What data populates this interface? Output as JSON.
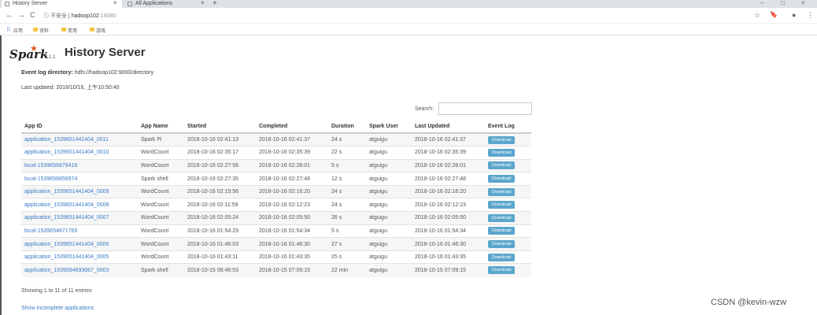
{
  "browser": {
    "tabs": [
      {
        "title": "History Server",
        "active": true
      },
      {
        "title": "All Applications",
        "active": false
      }
    ],
    "new_tab": "+",
    "window_controls": [
      "–",
      "□",
      "×"
    ],
    "nav": {
      "back": "←",
      "forward": "→",
      "reload": "C"
    },
    "address": {
      "info": "ⓘ",
      "insecure": "不安全",
      "sep": "|",
      "host": "hadoop102",
      "port": ":18080"
    },
    "right_icons": [
      "☆",
      "🔖",
      "●",
      "⋮"
    ],
    "bookmarks": {
      "apps": "⠿",
      "items": [
        "应用",
        "资料",
        "常用",
        "游戏"
      ]
    }
  },
  "page": {
    "logo_text": "Spark",
    "logo_star": "★",
    "version": "2.1.1",
    "title": "History Server",
    "event_log_label": "Event log directory:",
    "event_log_value": "hdfs://hadoop102:9000/directory",
    "last_updated": "Last updated: 2018/10/16, 上午10:50:40",
    "search_label": "Search:",
    "search_value": ""
  },
  "table": {
    "columns": [
      "App ID",
      "App Name",
      "Started",
      "Completed",
      "Duration",
      "Spark User",
      "Last Updated",
      "Event Log"
    ],
    "download_label": "Download",
    "rows": [
      [
        "application_1539651441404_0011",
        "Spark Pi",
        "2018-10-16 02:41:13",
        "2018-10-16 02:41:37",
        "24 s",
        "atguigu",
        "2018-10-16 02:41:37"
      ],
      [
        "application_1539651441404_0010",
        "WordCount",
        "2018-10-16 02:35:17",
        "2018-10-16 02:35:39",
        "22 s",
        "atguigu",
        "2018-10-16 02:35:39"
      ],
      [
        "local-1539656878416",
        "WordCount",
        "2018-10-16 02:27:56",
        "2018-10-16 02:28:01",
        "5 s",
        "atguigu",
        "2018-10-16 02:28:01"
      ],
      [
        "local-1539656856974",
        "Spark shell",
        "2018-10-16 02:27:35",
        "2018-10-16 02:27:48",
        "12 s",
        "atguigu",
        "2018-10-16 02:27:48"
      ],
      [
        "application_1539651441404_0009",
        "WordCount",
        "2018-10-16 02:15:56",
        "2018-10-16 02:16:20",
        "24 s",
        "atguigu",
        "2018-10-16 02:16:20"
      ],
      [
        "application_1539651441404_0008",
        "WordCount",
        "2018-10-16 02:11:59",
        "2018-10-16 02:12:23",
        "24 s",
        "atguigu",
        "2018-10-16 02:12:23"
      ],
      [
        "application_1539651441404_0007",
        "WordCount",
        "2018-10-16 02:05:24",
        "2018-10-16 02:05:50",
        "26 s",
        "atguigu",
        "2018-10-16 02:05:50"
      ],
      [
        "local-1539654871765",
        "WordCount",
        "2018-10-16 01:54:29",
        "2018-10-16 01:54:34",
        "5 s",
        "atguigu",
        "2018-10-16 01:54:34"
      ],
      [
        "application_1539651441404_0006",
        "WordCount",
        "2018-10-16 01:46:03",
        "2018-10-16 01:46:30",
        "27 s",
        "atguigu",
        "2018-10-16 01:46:30"
      ],
      [
        "application_1539651441404_0005",
        "WordCount",
        "2018-10-16 01:43:11",
        "2018-10-16 01:43:35",
        "25 s",
        "atguigu",
        "2018-10-16 01:43:35"
      ],
      [
        "application_1539564693667_0003",
        "Spark shell",
        "2018-10-15 06:46:53",
        "2018-10-15 07:09:15",
        "22 min",
        "atguigu",
        "2018-10-15 07:09:15"
      ]
    ]
  },
  "footer": {
    "showing": "Showing 1 to 11 of 11 entries",
    "incomplete_link": "Show incomplete applications",
    "watermark": "CSDN @kevin-wzw"
  }
}
